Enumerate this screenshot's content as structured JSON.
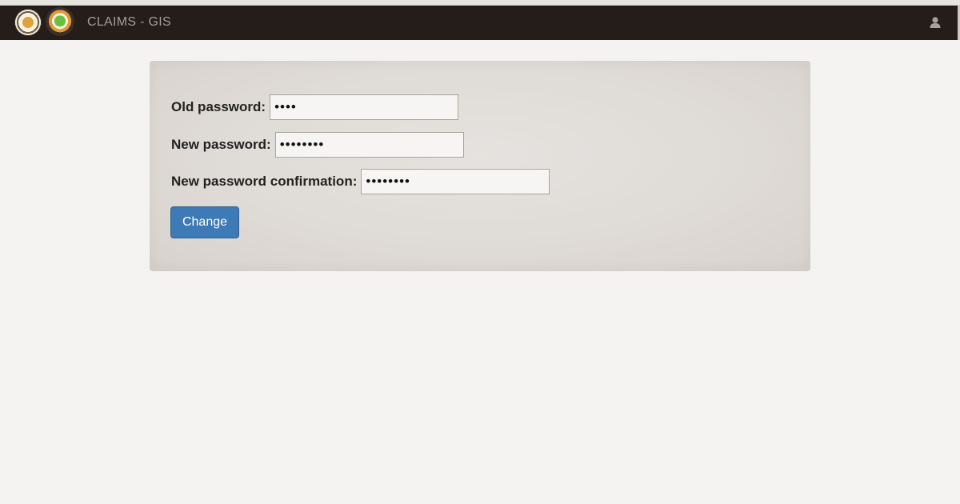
{
  "navbar": {
    "brand": "CLAIMS - GIS",
    "logos": [
      "state-seal-logo",
      "claims-gis-logo"
    ],
    "user_icon": "user-icon"
  },
  "form": {
    "old_password_label": "Old password:",
    "old_password_value": "••••",
    "new_password_label": "New password:",
    "new_password_value": "••••••••",
    "confirm_label": "New password confirmation:",
    "confirm_value": "••••••••",
    "submit_label": "Change"
  },
  "colors": {
    "navbar": "#241d1a",
    "button": "#3e7ab5",
    "panel": "#e0dcd8",
    "page": "#f4f3f1"
  }
}
